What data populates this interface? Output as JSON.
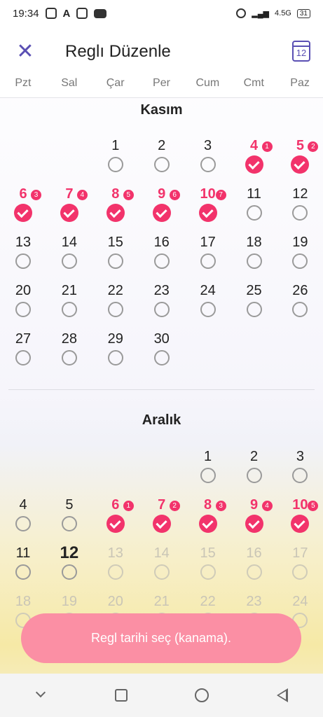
{
  "status_bar": {
    "time": "19:34",
    "network": "4.5G",
    "battery": "31"
  },
  "header": {
    "title": "Reglı Düzenle",
    "calendar_icon_day": "12"
  },
  "weekdays": [
    "Pzt",
    "Sal",
    "Çar",
    "Per",
    "Cum",
    "Cmt",
    "Paz"
  ],
  "months": [
    {
      "name": "Kasım",
      "days": [
        {
          "d": "1",
          "col": 2,
          "row": 0
        },
        {
          "d": "2",
          "col": 3,
          "row": 0
        },
        {
          "d": "3",
          "col": 4,
          "row": 0
        },
        {
          "d": "4",
          "col": 5,
          "row": 0,
          "sel": true,
          "badge": "1"
        },
        {
          "d": "5",
          "col": 6,
          "row": 0,
          "sel": true,
          "badge": "2"
        },
        {
          "d": "6",
          "col": 0,
          "row": 1,
          "sel": true,
          "badge": "3"
        },
        {
          "d": "7",
          "col": 1,
          "row": 1,
          "sel": true,
          "badge": "4"
        },
        {
          "d": "8",
          "col": 2,
          "row": 1,
          "sel": true,
          "badge": "5"
        },
        {
          "d": "9",
          "col": 3,
          "row": 1,
          "sel": true,
          "badge": "6"
        },
        {
          "d": "10",
          "col": 4,
          "row": 1,
          "sel": true,
          "badge": "7"
        },
        {
          "d": "11",
          "col": 5,
          "row": 1
        },
        {
          "d": "12",
          "col": 6,
          "row": 1
        },
        {
          "d": "13",
          "col": 0,
          "row": 2
        },
        {
          "d": "14",
          "col": 1,
          "row": 2
        },
        {
          "d": "15",
          "col": 2,
          "row": 2
        },
        {
          "d": "16",
          "col": 3,
          "row": 2
        },
        {
          "d": "17",
          "col": 4,
          "row": 2
        },
        {
          "d": "18",
          "col": 5,
          "row": 2
        },
        {
          "d": "19",
          "col": 6,
          "row": 2
        },
        {
          "d": "20",
          "col": 0,
          "row": 3
        },
        {
          "d": "21",
          "col": 1,
          "row": 3
        },
        {
          "d": "22",
          "col": 2,
          "row": 3
        },
        {
          "d": "23",
          "col": 3,
          "row": 3
        },
        {
          "d": "24",
          "col": 4,
          "row": 3
        },
        {
          "d": "25",
          "col": 5,
          "row": 3
        },
        {
          "d": "26",
          "col": 6,
          "row": 3
        },
        {
          "d": "27",
          "col": 0,
          "row": 4
        },
        {
          "d": "28",
          "col": 1,
          "row": 4
        },
        {
          "d": "29",
          "col": 2,
          "row": 4
        },
        {
          "d": "30",
          "col": 3,
          "row": 4
        }
      ]
    },
    {
      "name": "Aralık",
      "days": [
        {
          "d": "1",
          "col": 4,
          "row": 0
        },
        {
          "d": "2",
          "col": 5,
          "row": 0
        },
        {
          "d": "3",
          "col": 6,
          "row": 0
        },
        {
          "d": "4",
          "col": 0,
          "row": 1
        },
        {
          "d": "5",
          "col": 1,
          "row": 1
        },
        {
          "d": "6",
          "col": 2,
          "row": 1,
          "sel": true,
          "badge": "1"
        },
        {
          "d": "7",
          "col": 3,
          "row": 1,
          "sel": true,
          "badge": "2"
        },
        {
          "d": "8",
          "col": 4,
          "row": 1,
          "sel": true,
          "badge": "3"
        },
        {
          "d": "9",
          "col": 5,
          "row": 1,
          "sel": true,
          "badge": "4"
        },
        {
          "d": "10",
          "col": 6,
          "row": 1,
          "sel": true,
          "badge": "5"
        },
        {
          "d": "11",
          "col": 0,
          "row": 2
        },
        {
          "d": "12",
          "col": 1,
          "row": 2,
          "today": true
        },
        {
          "d": "13",
          "col": 2,
          "row": 2,
          "faded": true
        },
        {
          "d": "14",
          "col": 3,
          "row": 2,
          "faded": true
        },
        {
          "d": "15",
          "col": 4,
          "row": 2,
          "faded": true
        },
        {
          "d": "16",
          "col": 5,
          "row": 2,
          "faded": true
        },
        {
          "d": "17",
          "col": 6,
          "row": 2,
          "faded": true
        },
        {
          "d": "18",
          "col": 0,
          "row": 3,
          "faded": true
        },
        {
          "d": "19",
          "col": 1,
          "row": 3,
          "faded": true
        },
        {
          "d": "20",
          "col": 2,
          "row": 3,
          "faded": true
        },
        {
          "d": "21",
          "col": 3,
          "row": 3,
          "faded": true
        },
        {
          "d": "22",
          "col": 4,
          "row": 3,
          "faded": true
        },
        {
          "d": "23",
          "col": 5,
          "row": 3,
          "faded": true
        },
        {
          "d": "24",
          "col": 6,
          "row": 3,
          "faded": true
        }
      ]
    }
  ],
  "cta_label": "Regl tarihi seç (kanama).",
  "colors": {
    "accent": "#5a4fb3",
    "period": "#f2336b",
    "cta": "#fb8fa4"
  },
  "icons": [
    "close-icon",
    "calendar-icon",
    "check-icon",
    "nav-collapse-icon",
    "nav-recents-icon",
    "nav-home-icon",
    "nav-back-icon"
  ]
}
